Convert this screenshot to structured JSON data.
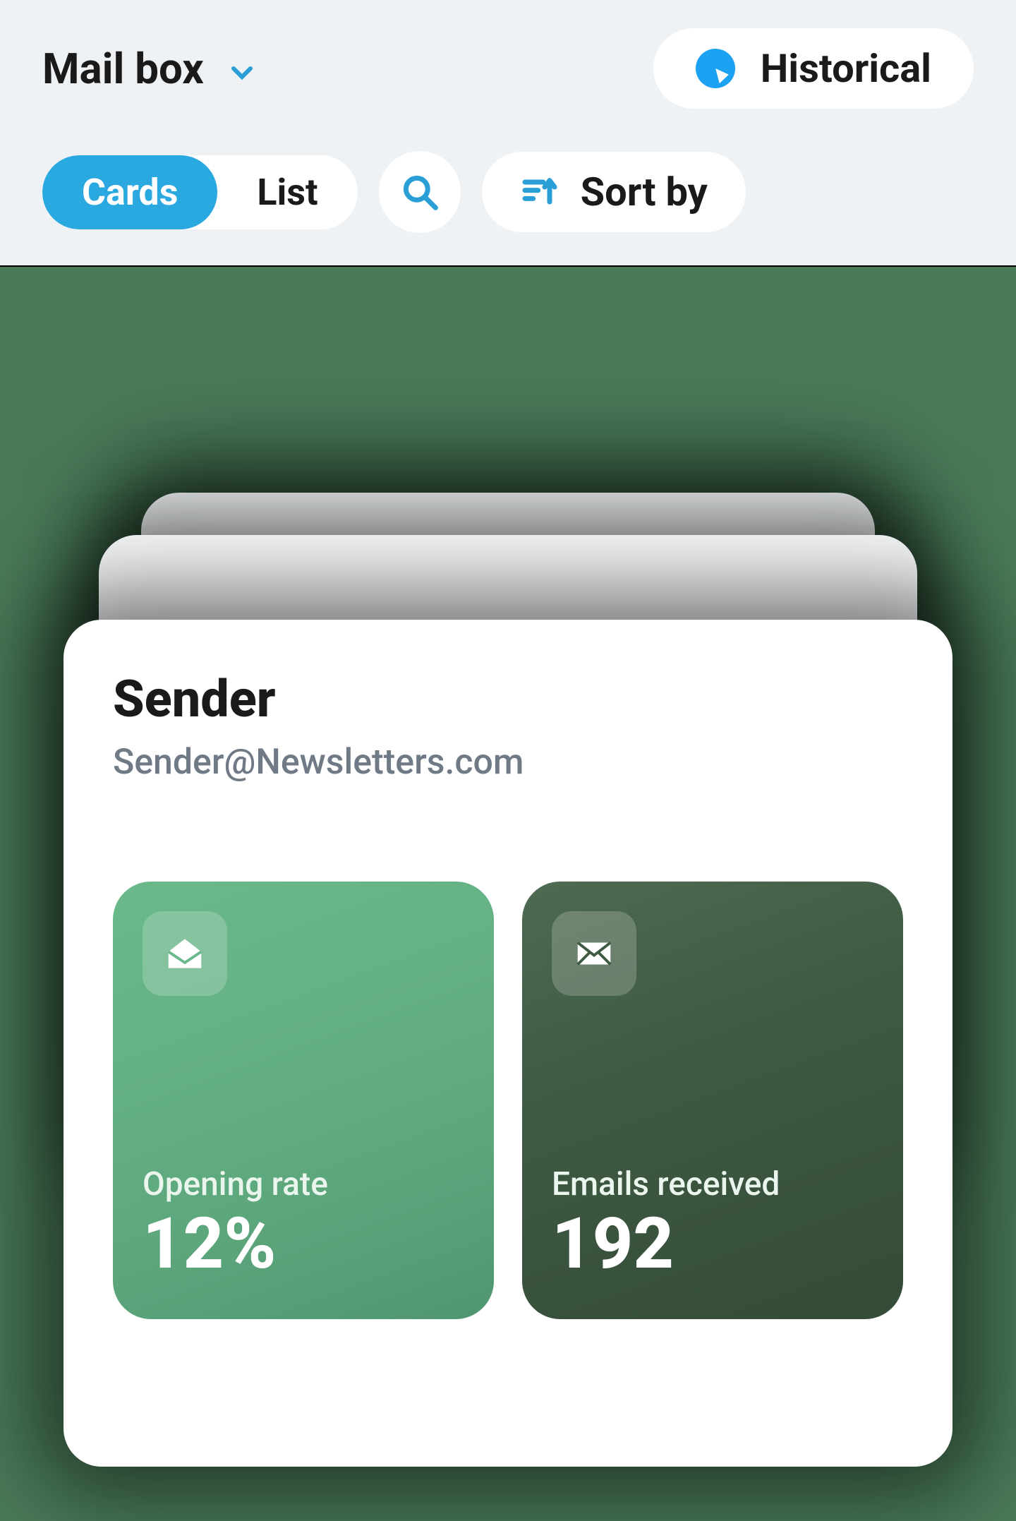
{
  "header": {
    "mailbox_label": "Mail box",
    "historical_label": "Historical"
  },
  "toolbar": {
    "view_cards_label": "Cards",
    "view_list_label": "List",
    "sort_label": "Sort by"
  },
  "card": {
    "sender_title": "Sender",
    "sender_email": "Sender@Newsletters.com",
    "stats": {
      "opening_rate": {
        "label": "Opening rate",
        "value": "12%"
      },
      "emails_received": {
        "label": "Emails received",
        "value": "192"
      }
    }
  }
}
